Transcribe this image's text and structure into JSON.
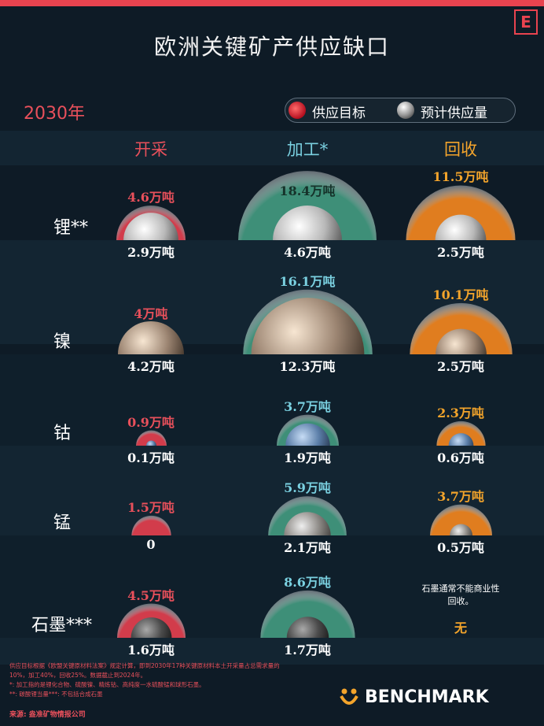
{
  "title": "欧洲关键矿产供应缺口",
  "year": "2030年",
  "legend": {
    "target": "供应目标",
    "forecast": "预计供应量"
  },
  "logo_letter": "E",
  "colors": {
    "mining": "#e8505b",
    "processing": "#7ad0e0",
    "recycling": "#f3a42b",
    "accent": "#e8434f"
  },
  "chart_data": {
    "type": "bubble",
    "title": "欧洲关键矿产供应缺口",
    "unit": "万吨",
    "categories": [
      "开采",
      "加工*",
      "回收"
    ],
    "rows": [
      {
        "label": "锂**",
        "material": "silver",
        "values": [
          {
            "target": 4.6,
            "forecast": 2.9,
            "target_label": "4.6万吨",
            "forecast_label": "2.9万吨"
          },
          {
            "target": 18.4,
            "forecast": 4.6,
            "target_label": "18.4万吨",
            "forecast_label": "4.6万吨"
          },
          {
            "target": 11.5,
            "forecast": 2.5,
            "target_label": "11.5万吨",
            "forecast_label": "2.5万吨"
          }
        ]
      },
      {
        "label": "镍",
        "material": "bronze",
        "values": [
          {
            "target": 4.0,
            "forecast": 4.2,
            "target_label": "4万吨",
            "forecast_label": "4.2万吨"
          },
          {
            "target": 16.1,
            "forecast": 12.3,
            "target_label": "16.1万吨",
            "forecast_label": "12.3万吨"
          },
          {
            "target": 10.1,
            "forecast": 2.5,
            "target_label": "10.1万吨",
            "forecast_label": "2.5万吨"
          }
        ]
      },
      {
        "label": "钴",
        "material": "blue",
        "values": [
          {
            "target": 0.9,
            "forecast": 0.1,
            "target_label": "0.9万吨",
            "forecast_label": "0.1万吨"
          },
          {
            "target": 3.7,
            "forecast": 1.9,
            "target_label": "3.7万吨",
            "forecast_label": "1.9万吨"
          },
          {
            "target": 2.3,
            "forecast": 0.6,
            "target_label": "2.3万吨",
            "forecast_label": "0.6万吨"
          }
        ]
      },
      {
        "label": "锰",
        "material": "grey",
        "values": [
          {
            "target": 1.5,
            "forecast": 0,
            "target_label": "1.5万吨",
            "forecast_label": "0"
          },
          {
            "target": 5.9,
            "forecast": 2.1,
            "target_label": "5.9万吨",
            "forecast_label": "2.1万吨"
          },
          {
            "target": 3.7,
            "forecast": 0.5,
            "target_label": "3.7万吨",
            "forecast_label": "0.5万吨"
          }
        ]
      },
      {
        "label": "石墨***",
        "material": "dark",
        "values": [
          {
            "target": 4.5,
            "forecast": 1.6,
            "target_label": "4.5万吨",
            "forecast_label": "1.6万吨"
          },
          {
            "target": 8.6,
            "forecast": 1.7,
            "target_label": "8.6万吨",
            "forecast_label": "1.7万吨"
          },
          {
            "target": null,
            "forecast": null,
            "target_label": "",
            "forecast_label": "无",
            "note": "石墨通常不能商业性回收。"
          }
        ]
      }
    ]
  },
  "footnotes": [
    "供应目标根据《欧盟关键原材料法案》规定计算，即到2030年17种关键原材料本土开采量占总需求量的10%，加工40%，回收25%。数据截止到2024年。",
    "*: 加工指的是锂化合物、硫酸镍、精炼钴、高纯度一水硫酸锰和球形石墨。",
    "**: 碳酸锂当量***: 不包括合成石墨"
  ],
  "source": "来源: 盎准矿物情报公司",
  "brand": "BENCHMARK"
}
